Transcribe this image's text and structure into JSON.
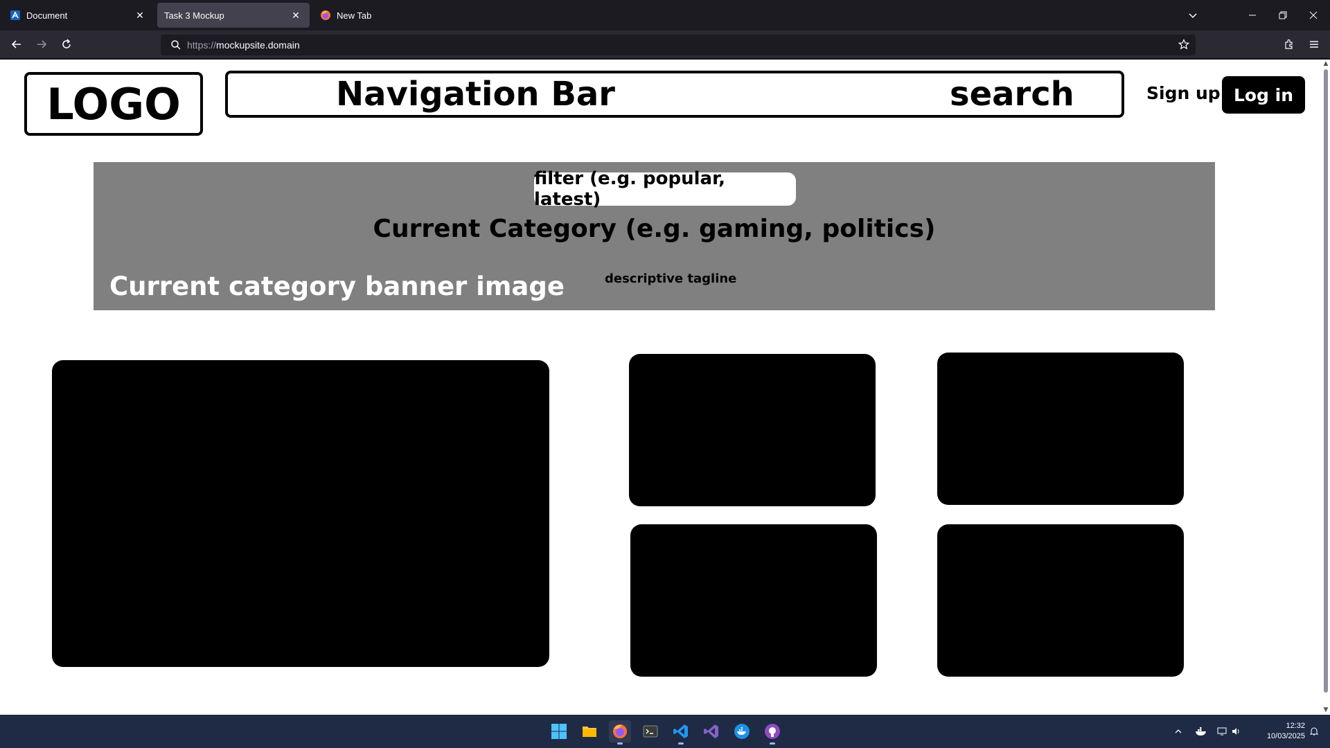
{
  "browser": {
    "tabs": [
      {
        "label": "Document",
        "icon": "app-icon",
        "active": false
      },
      {
        "label": "Task 3 Mockup",
        "icon": "none",
        "active": true
      },
      {
        "label": "New Tab",
        "icon": "firefox-icon",
        "active": false
      }
    ],
    "url_scheme": "https://",
    "url_host": "mockupsite.domain"
  },
  "page": {
    "logo": "LOGO",
    "nav_title": "Navigation Bar",
    "nav_search": "search",
    "signup": "Sign up",
    "login": "Log in",
    "banner": {
      "filter": "filter (e.g. popular, latest)",
      "category_title": "Current Category (e.g. gaming, politics)",
      "banner_image_label": "Current category banner image",
      "tagline": "descriptive tagline"
    }
  },
  "taskbar": {
    "time": "12:32",
    "date": "10/03/2025"
  },
  "colors": {
    "tab_bg": "#1c1b22",
    "toolbar_bg": "#2b2a33",
    "banner_gray": "#808080",
    "taskbar_bg": "#1f2a44"
  }
}
